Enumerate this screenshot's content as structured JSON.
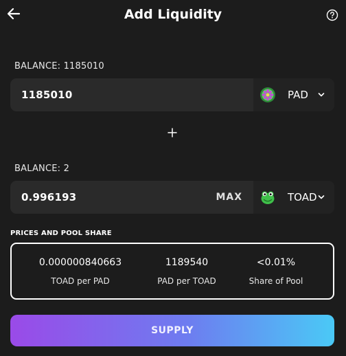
{
  "header": {
    "title": "Add Liquidity",
    "back_icon": "arrow-left-icon",
    "help_icon": "question-circle-icon"
  },
  "input_a": {
    "balance_label": "BALANCE: 1185010",
    "value": "1185010",
    "token_symbol": "PAD",
    "token_icon": "pad-token-icon"
  },
  "plus_icon": "plus-icon",
  "input_b": {
    "balance_label": "BALANCE: 2",
    "value": "0.996193",
    "max_label": "MAX",
    "token_symbol": "TOAD",
    "token_icon": "toad-token-icon"
  },
  "prices": {
    "title": "PRICES AND POOL SHARE",
    "items": [
      {
        "value": "0.000000840663",
        "label": "TOAD per PAD"
      },
      {
        "value": "1189540",
        "label": "PAD per TOAD"
      },
      {
        "value": "<0.01%",
        "label": "Share of Pool"
      }
    ]
  },
  "supply_label": "SUPPLY",
  "colors": {
    "background": "#1c1c1c",
    "field": "#2a2a2a",
    "gradient_start": "#9a4ae8",
    "gradient_end": "#4ac9f6"
  }
}
